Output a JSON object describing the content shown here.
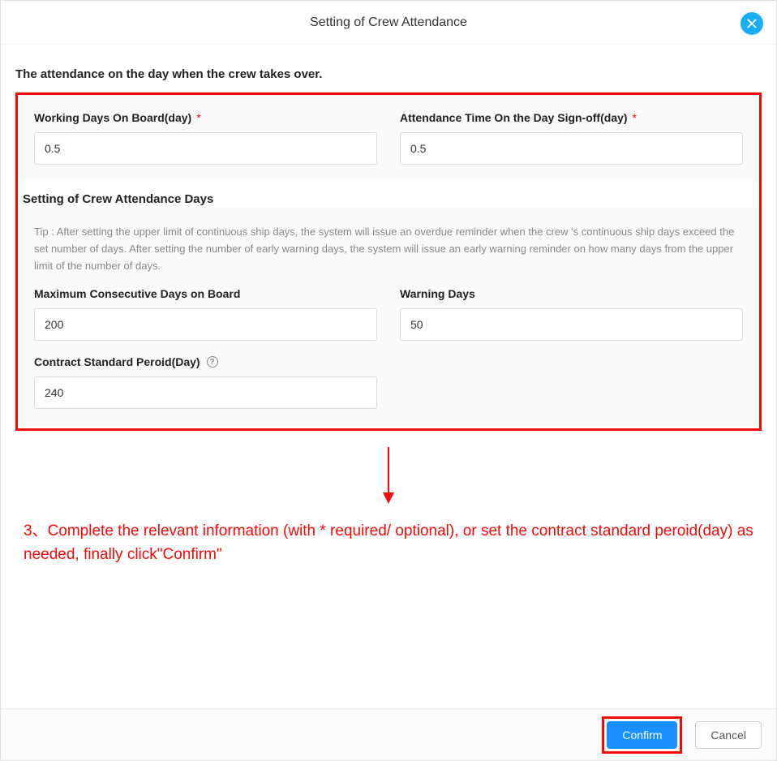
{
  "dialog": {
    "title": "Setting of Crew Attendance"
  },
  "sections": {
    "takeover_title": "The attendance on the day when the crew takes over.",
    "days_title": "Setting of Crew Attendance Days"
  },
  "fields": {
    "working_days": {
      "label": "Working Days On Board(day)",
      "value": "0.5",
      "required": "*"
    },
    "signoff_attendance": {
      "label": "Attendance Time On the Day Sign-off(day)",
      "value": "0.5",
      "required": "*"
    },
    "max_consecutive": {
      "label": "Maximum Consecutive Days on Board",
      "value": "200"
    },
    "warning_days": {
      "label": "Warning Days",
      "value": "50"
    },
    "contract_period": {
      "label": "Contract Standard Peroid(Day)",
      "value": "240"
    }
  },
  "tip": "Tip : After setting the upper limit of continuous ship days, the system will issue an overdue reminder when the crew 's continuous ship days exceed the set number of days. After setting the number of early warning days, the system will issue an early warning reminder on how many days from the upper limit of the number of days.",
  "instruction": "3、Complete the relevant information (with * required/ optional), or set the contract standard peroid(day) as needed, finally click\"Confirm\"",
  "buttons": {
    "confirm": "Confirm",
    "cancel": "Cancel"
  },
  "colors": {
    "accent": "#1890ff",
    "highlight": "#f40808",
    "close_bg": "#1aaef7"
  }
}
